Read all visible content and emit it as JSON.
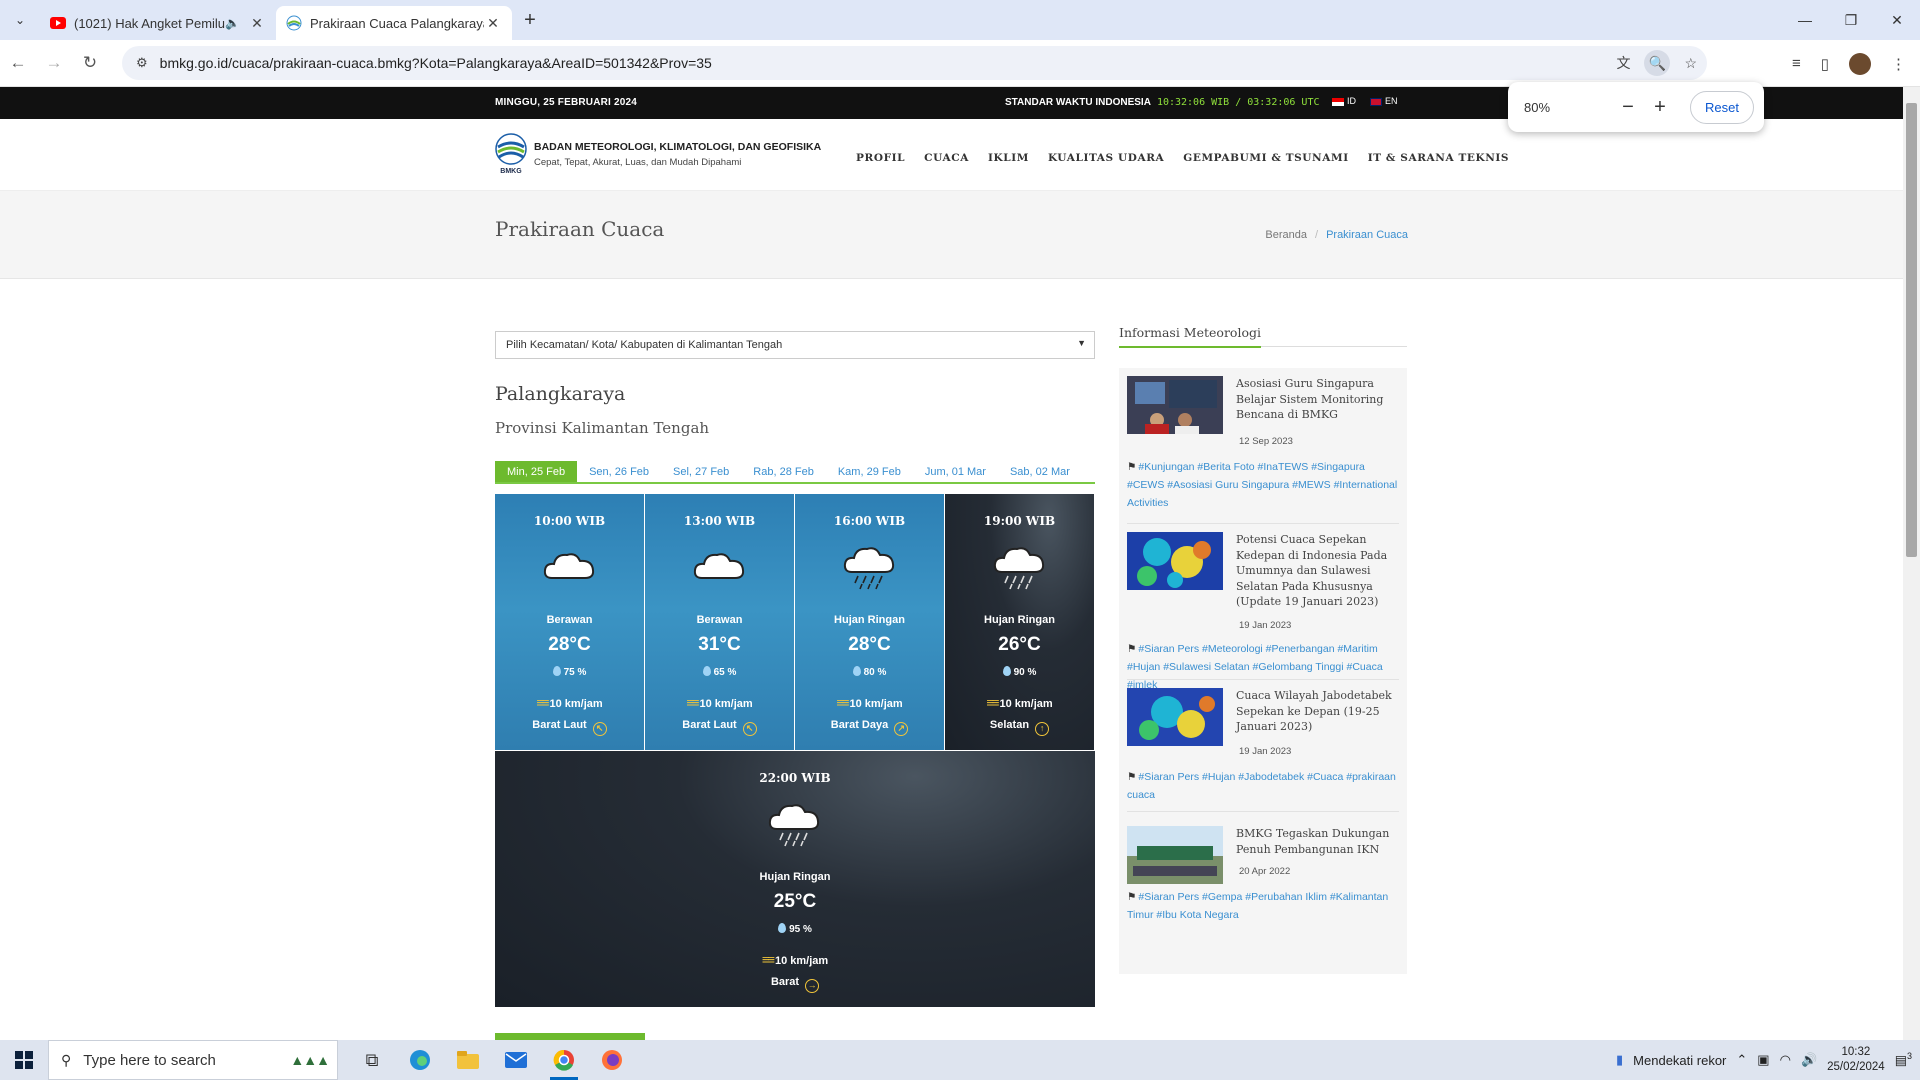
{
  "browser": {
    "tabs": [
      {
        "title": "(1021) Hak Angket Pemilu, ",
        "icon": "youtube-icon",
        "audio": true,
        "active": false
      },
      {
        "title": "Prakiraan Cuaca Palangkaraya -",
        "icon": "bmkg-favicon",
        "active": true
      }
    ],
    "url": "bmkg.go.id/cuaca/prakiraan-cuaca.bmkg?Kota=Palangkaraya&AreaID=501342&Prov=35",
    "zoom": {
      "value": "80%",
      "minus": "−",
      "plus": "+",
      "reset": "Reset"
    }
  },
  "topstrip": {
    "date": "MINGGU, 25 FEBRUARI 2024",
    "wib_label": "STANDAR WAKTU INDONESIA",
    "clock": "10:32:06 WIB / 03:32:06 UTC",
    "lang_id": "ID",
    "lang_en": "EN"
  },
  "header": {
    "org_name": "BADAN METEOROLOGI, KLIMATOLOGI, DAN GEOFISIKA",
    "tagline": "Cepat, Tepat, Akurat, Luas, dan Mudah Dipahami",
    "logo_text": "BMKG",
    "nav": [
      "PROFIL",
      "CUACA",
      "IKLIM",
      "KUALITAS UDARA",
      "GEMPABUMI & TSUNAMI",
      "IT & SARANA TEKNIS"
    ]
  },
  "titlebar": {
    "title": "Prakiraan Cuaca",
    "breadcrumb_home": "Beranda",
    "breadcrumb_sep": "/",
    "breadcrumb_current": "Prakiraan Cuaca"
  },
  "location": {
    "select_placeholder": "Pilih Kecamatan/ Kota/ Kabupaten di Kalimantan Tengah",
    "city": "Palangkaraya",
    "province": "Provinsi Kalimantan Tengah"
  },
  "day_tabs": [
    "Min, 25 Feb",
    "Sen, 26 Feb",
    "Sel, 27 Feb",
    "Rab, 28 Feb",
    "Kam, 29 Feb",
    "Jum, 01 Mar",
    "Sab, 02 Mar"
  ],
  "forecast": [
    {
      "time": "10:00 WIB",
      "condition": "Berawan",
      "temp": "28°C",
      "humidity": "75 %",
      "wind": "10 km/jam",
      "direction": "Barat Laut",
      "icon": "cloudy-icon",
      "theme": "day"
    },
    {
      "time": "13:00 WIB",
      "condition": "Berawan",
      "temp": "31°C",
      "humidity": "65 %",
      "wind": "10 km/jam",
      "direction": "Barat Laut",
      "icon": "cloudy-icon",
      "theme": "day"
    },
    {
      "time": "16:00 WIB",
      "condition": "Hujan Ringan",
      "temp": "28°C",
      "humidity": "80 %",
      "wind": "10 km/jam",
      "direction": "Barat Daya",
      "icon": "light-rain-icon",
      "theme": "day"
    },
    {
      "time": "19:00 WIB",
      "condition": "Hujan Ringan",
      "temp": "26°C",
      "humidity": "90 %",
      "wind": "10 km/jam",
      "direction": "Selatan",
      "icon": "light-rain-icon",
      "theme": "night"
    },
    {
      "time": "22:00 WIB",
      "condition": "Hujan Ringan",
      "temp": "25°C",
      "humidity": "95 %",
      "wind": "10 km/jam",
      "direction": "Barat",
      "icon": "light-rain-icon",
      "theme": "night"
    }
  ],
  "sidebar": {
    "heading": "Informasi Meteorologi",
    "news": [
      {
        "title": "Asosiasi Guru Singapura Belajar Sistem Monitoring Bencana di BMKG",
        "date": "12 Sep 2023",
        "tags": "#Kunjungan #Berita Foto #InaTEWS #Singapura #CEWS #Asosiasi Guru Singapura #MEWS #International Activities"
      },
      {
        "title": "Potensi Cuaca Sepekan Kedepan di Indonesia Pada Umumnya dan Sulawesi Selatan Pada Khususnya (Update 19 Januari 2023)",
        "date": "19 Jan 2023",
        "tags": "#Siaran Pers #Meteorologi #Penerbangan #Maritim #Hujan #Sulawesi Selatan #Gelombang Tinggi #Cuaca #imlek"
      },
      {
        "title": "Cuaca Wilayah Jabodetabek Sepekan ke Depan (19-25 Januari 2023)",
        "date": "19 Jan 2023",
        "tags": "#Siaran Pers #Hujan #Jabodetabek #Cuaca #prakiraan cuaca"
      },
      {
        "title": "BMKG Tegaskan Dukungan Penuh Pembangunan IKN",
        "date": "20 Apr 2022",
        "tags": "#Siaran Pers #Gempa #Perubahan Iklim #Kalimantan Timur #Ibu Kota Negara"
      }
    ]
  },
  "taskbar": {
    "search_placeholder": "Type here to search",
    "weather_text": "Mendekati rekor",
    "time": "10:32",
    "date": "25/02/2024",
    "notif_count": "3"
  },
  "colors": {
    "accent_green": "#6dba2e",
    "link_blue": "#3a8fd0",
    "clock_green": "#8fe03b"
  }
}
